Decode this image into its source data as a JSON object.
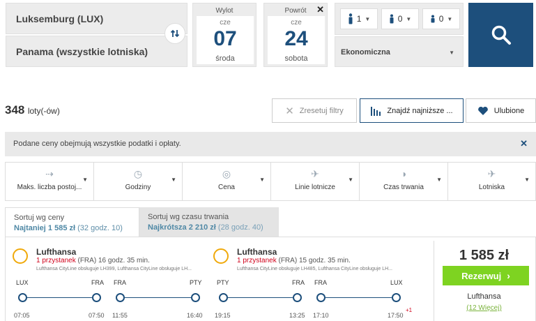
{
  "search": {
    "from": "Luksemburg (LUX)",
    "to": "Panama (wszystkie lotniska)",
    "departure": {
      "label": "Wylot",
      "dow_short": "cze",
      "day": "07",
      "weekday": "środa"
    },
    "return": {
      "label": "Powrót",
      "dow_short": "cze",
      "day": "24",
      "weekday": "sobota"
    },
    "passengers": [
      {
        "icon": "adult-icon",
        "count": "1"
      },
      {
        "icon": "child-icon",
        "count": "0"
      },
      {
        "icon": "infant-icon",
        "count": "0"
      }
    ],
    "cabin_class": "Ekonomiczna"
  },
  "results": {
    "count": "348",
    "count_suffix": "loty(-ów)",
    "reset_label": "Zresetuj filtry",
    "lowest_label": "Znajdź najniższe ...",
    "favorites_label": "Ulubione"
  },
  "notice": {
    "text": "Podane ceny obejmują wszystkie podatki i opłaty."
  },
  "filters": [
    {
      "icon": "stops-icon",
      "label": "Maks. liczba postoj..."
    },
    {
      "icon": "clock-icon",
      "label": "Godziny"
    },
    {
      "icon": "coins-icon",
      "label": "Cena"
    },
    {
      "icon": "plane-icon",
      "label": "Linie lotnicze"
    },
    {
      "icon": "duration-icon",
      "label": "Czas trwania"
    },
    {
      "icon": "airport-icon",
      "label": "Lotniska"
    }
  ],
  "sort": {
    "price": {
      "title": "Sortuj wg ceny",
      "best": "Najtaniej",
      "price": "1 585 zł",
      "detail": "(32 godz. 10)"
    },
    "duration": {
      "title": "Sortuj wg czasu trwania",
      "best": "Najkrótsza",
      "price": "2 210 zł",
      "detail": "(28 godz. 40)"
    }
  },
  "flight": {
    "outbound": {
      "airline": "Lufthansa",
      "stops": "1 przystanek",
      "stop_airport": "(FRA)",
      "duration": "16 godz. 35 min.",
      "operated": "Lufthansa CityLine obsługuje LH399, Lufthansa CityLine obsługuje LH...",
      "airports": [
        "LUX",
        "FRA",
        "FRA",
        "PTY"
      ],
      "times": [
        "07:05",
        "07:50",
        "11:55",
        "16:40"
      ]
    },
    "inbound": {
      "airline": "Lufthansa",
      "stops": "1 przystanek",
      "stop_airport": "(FRA)",
      "duration": "15 godz. 35 min.",
      "operated": "Lufthansa CityLine obsługuje LH485, Lufthansa CityLine obsługuje LH...",
      "airports": [
        "PTY",
        "FRA",
        "FRA",
        "LUX"
      ],
      "times": [
        "19:15",
        "13:25",
        "17:10",
        "17:50"
      ],
      "next_day": "+1"
    },
    "price": "1 585 zł",
    "reserve_label": "Rezerwuj",
    "carrier": "Lufthansa",
    "more": "(12 Więcej)"
  },
  "colors": {
    "brand": "#1d4f7c",
    "reserve": "#7ed321",
    "stops": "#d0021b"
  }
}
